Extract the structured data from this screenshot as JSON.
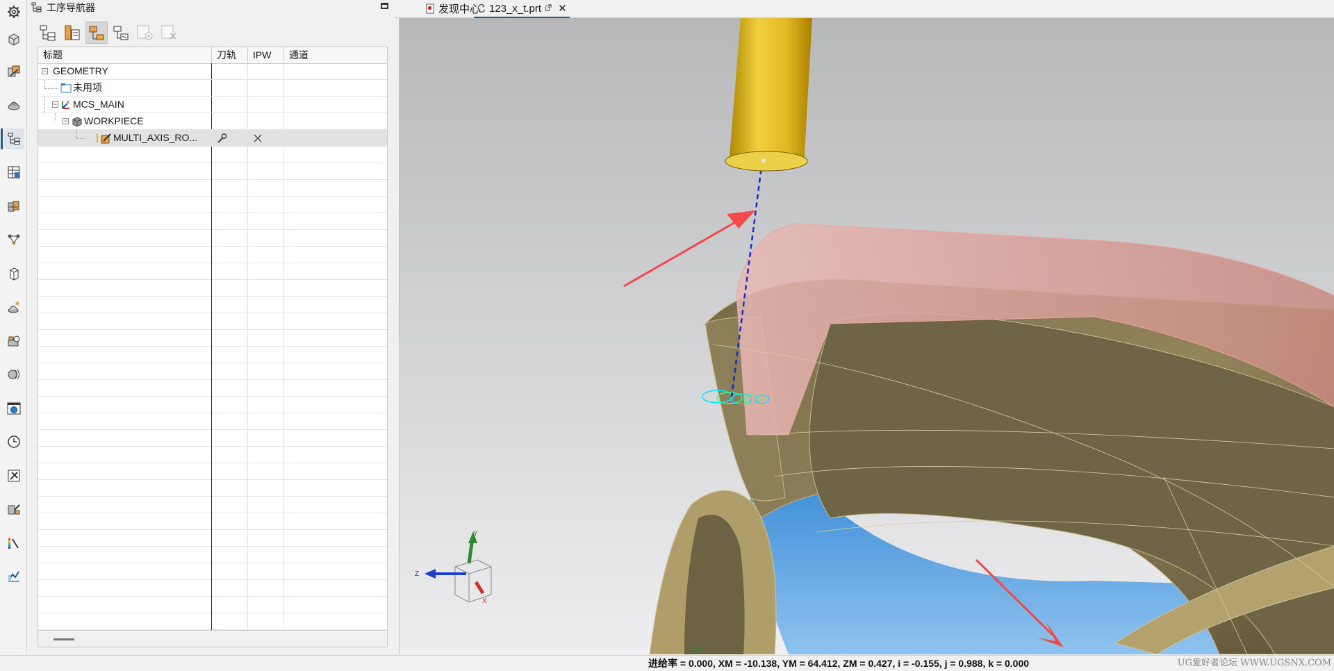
{
  "navigator": {
    "title": "工序导航器",
    "columns": [
      "标题",
      "刀轨",
      "IPW",
      "通道"
    ],
    "rows": [
      {
        "name": "GEOMETRY",
        "icon": "geometry-root-icon",
        "level": 0,
        "expander": "−"
      },
      {
        "name": "未用项",
        "icon": "unused-folder-icon",
        "level": 1
      },
      {
        "name": "MCS_MAIN",
        "icon": "mcs-icon",
        "level": 1,
        "expander": "−"
      },
      {
        "name": "WORKPIECE",
        "icon": "workpiece-icon",
        "level": 2,
        "expander": "−"
      },
      {
        "name": "MULTI_AXIS_RO...",
        "icon": "operation-icon",
        "level": 3,
        "toolpath_icon": "wrench-icon",
        "ipw_icon": "close-x-icon",
        "selected": true
      }
    ],
    "toolbar": [
      "program-order-view-icon",
      "machine-tool-view-icon",
      "geometry-view-icon",
      "machining-method-view-icon",
      "create-operation-icon",
      "delete-operation-icon"
    ]
  },
  "tabs": [
    {
      "label": "发现中心",
      "icon": "discovery-icon",
      "active": false
    },
    {
      "label": "123_x_t.prt",
      "icon": "part-sync-icon",
      "active": true,
      "close": "✕"
    }
  ],
  "viewport": {
    "axes": {
      "x": "X",
      "y": "Y",
      "z": "Z",
      "ym": "YM"
    }
  },
  "status": {
    "readout": "进给率 = 0.000, XM = -10.138, YM = 64.412, ZM = 0.427, i = -0.155, j = 0.988, k = 0.000",
    "watermark": "UG爱好者论坛 WWW.UGSNX.COM"
  },
  "rail_icons": [
    "settings-gear-icon",
    "part-navigator-icon",
    "assembly-navigator-icon",
    "constraint-navigator-icon",
    "operation-navigator-icon",
    "machine-navigator-icon",
    "feature-navigator-icon",
    "relations-icon",
    "part-icon",
    "reuse-library-icon",
    "role-icon",
    "history-icon",
    "web-browser-icon",
    "clock-icon",
    "tool-icon",
    "process-icon",
    "color-legend-icon",
    "analysis-icon"
  ]
}
